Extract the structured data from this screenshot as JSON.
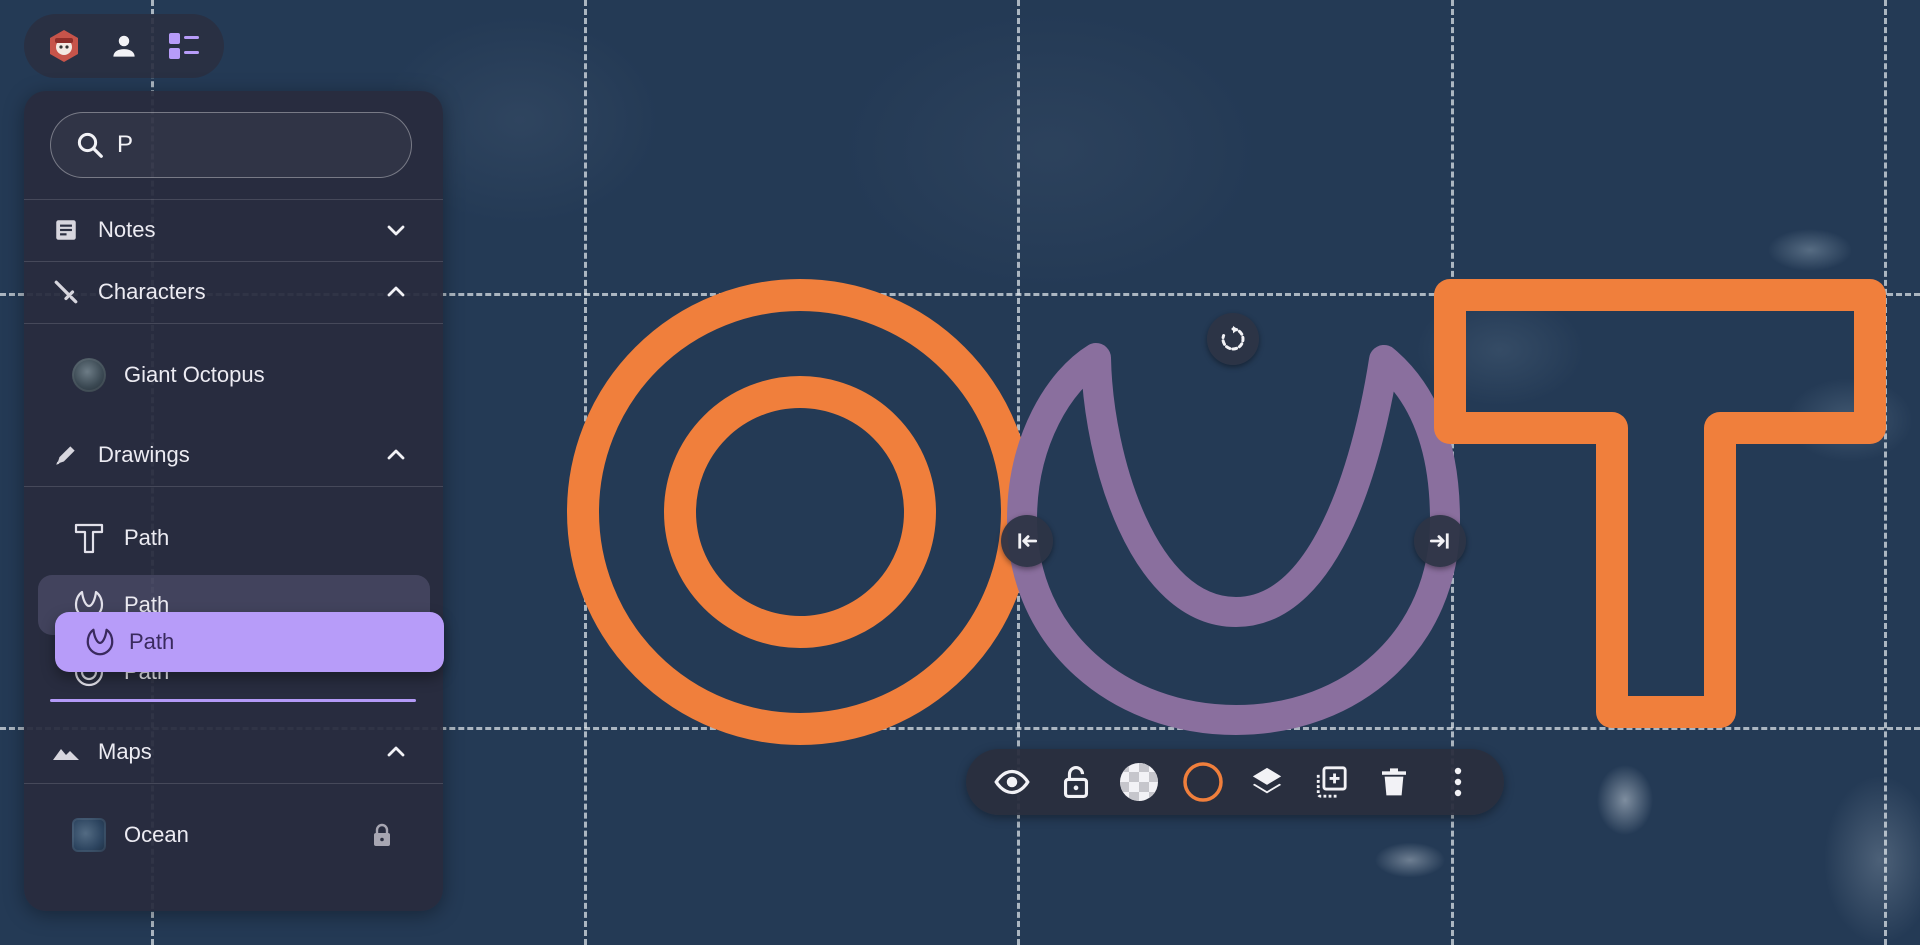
{
  "search": {
    "value": "P",
    "placeholder": "Search"
  },
  "sections": {
    "notes": {
      "label": "Notes"
    },
    "characters": {
      "label": "Characters",
      "items": [
        {
          "label": "Giant Octopus"
        }
      ]
    },
    "drawings": {
      "label": "Drawings",
      "items": [
        {
          "label": "Path",
          "icon": "text-path-icon"
        },
        {
          "label": "Path",
          "icon": "arc-path-icon"
        },
        {
          "label": "Path",
          "icon": "ring-path-icon"
        }
      ]
    },
    "maps": {
      "label": "Maps",
      "items": [
        {
          "label": "Ocean",
          "locked": true
        }
      ]
    }
  },
  "drag_ghost": {
    "label": "Path"
  },
  "colors": {
    "accent": "#b79cf9",
    "orange_stroke": "#f07f3c",
    "purple_stroke": "#8a6f9e",
    "panel": "#282c3e",
    "map": "#243a55"
  },
  "toolbar": {
    "buttons": [
      "eye-icon",
      "lock-open-icon",
      "opacity-icon",
      "stroke-color-icon",
      "layers-icon",
      "duplicate-icon",
      "delete-icon",
      "more-icon"
    ]
  }
}
